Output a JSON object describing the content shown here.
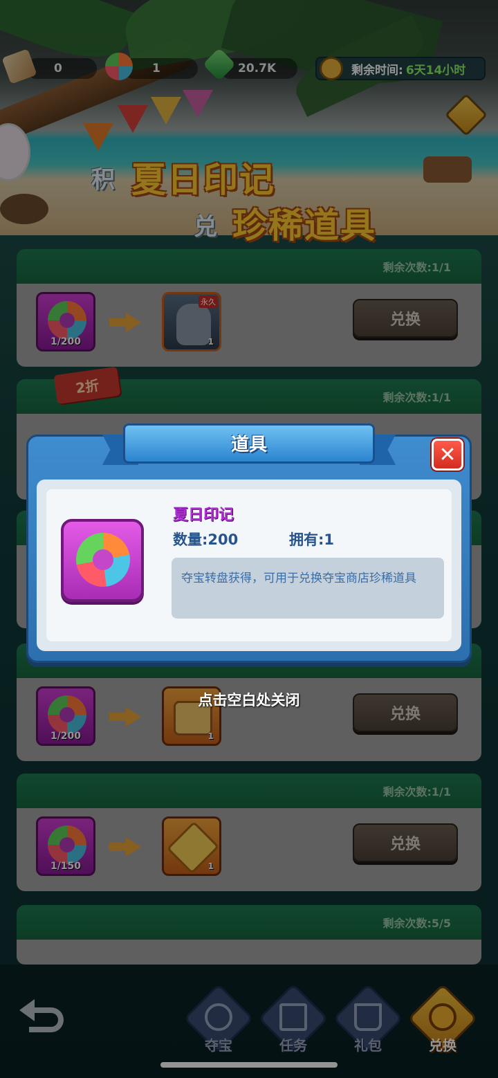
{
  "resources": [
    {
      "icon": "scroll-icon",
      "value": "0"
    },
    {
      "icon": "lifebuoy-icon",
      "value": "1"
    },
    {
      "icon": "gem-icon",
      "value": "20.7K"
    }
  ],
  "timer": {
    "label": "剩余时间:",
    "value": "6天14小时"
  },
  "banner": {
    "line1_small": "积",
    "line1_big": "夏日印记",
    "line2_small": "兑",
    "line2_big": "珍稀道具"
  },
  "cards": [
    {
      "remaining": "剩余次数:1/1",
      "cost": "1/200",
      "reward_count": "1",
      "reward_tag": "永久",
      "button": "兑换"
    },
    {
      "remaining": "剩余次数:1/1",
      "discount": "2折"
    },
    {
      "cost": "1/200",
      "reward_count": "1",
      "button": "兑换"
    },
    {
      "remaining": "剩余次数:1/1",
      "cost": "1/150",
      "reward_count": "1",
      "button": "兑换"
    },
    {
      "remaining": "剩余次数:5/5"
    }
  ],
  "modal": {
    "title": "道具",
    "close_symbol": "✕",
    "item_name": "夏日印记",
    "quantity": "数量:200",
    "owned": "拥有:1",
    "description": "夺宝转盘获得，可用于兑换夺宝商店珍稀道具",
    "tap_to_close": "点击空白处关闭"
  },
  "nav": {
    "back_icon": "back-arrow-icon",
    "items": [
      {
        "label": "夺宝",
        "icon": "wheel-icon",
        "active": false
      },
      {
        "label": "任务",
        "icon": "task-scroll-icon",
        "active": false
      },
      {
        "label": "礼包",
        "icon": "gift-cart-icon",
        "active": false
      },
      {
        "label": "兑换",
        "icon": "exchange-coin-icon",
        "active": true
      }
    ]
  },
  "colors": {
    "accent_gold": "#ffcc33",
    "header_green": "#1f7a52",
    "modal_blue": "#2c6fae",
    "close_red": "#d22c1f"
  }
}
